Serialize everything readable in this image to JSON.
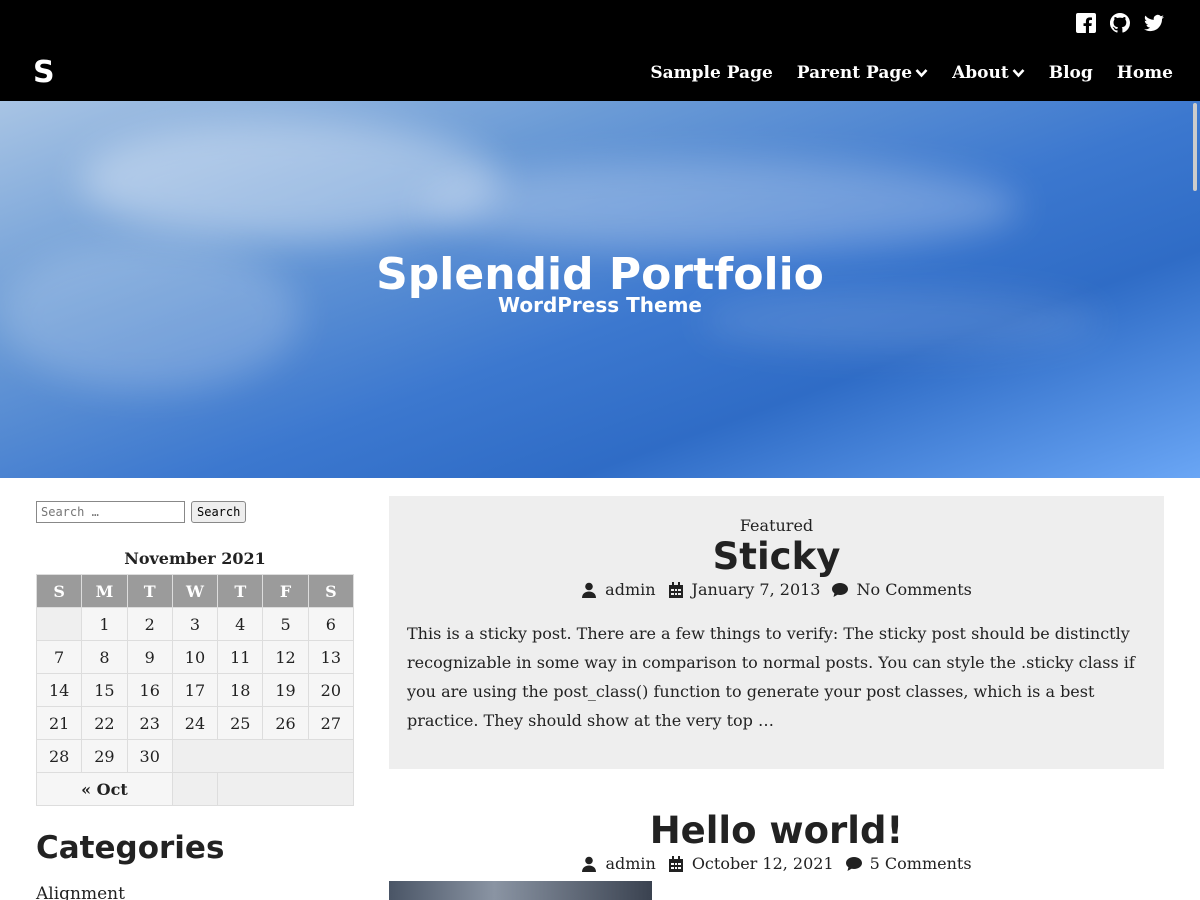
{
  "header": {
    "logo": "S",
    "social": [
      "facebook-icon",
      "github-icon",
      "twitter-icon"
    ],
    "nav": [
      {
        "label": "Sample Page",
        "dropdown": false
      },
      {
        "label": "Parent Page",
        "dropdown": true
      },
      {
        "label": "About",
        "dropdown": true
      },
      {
        "label": "Blog",
        "dropdown": false
      },
      {
        "label": "Home",
        "dropdown": false
      }
    ]
  },
  "hero": {
    "title": "Splendid Portfolio",
    "subtitle": "WordPress Theme"
  },
  "sidebar": {
    "search": {
      "placeholder": "Search …",
      "button": "Search"
    },
    "calendar": {
      "caption": "November 2021",
      "weekdays": [
        "S",
        "M",
        "T",
        "W",
        "T",
        "F",
        "S"
      ],
      "weeks": [
        [
          "",
          "1",
          "2",
          "3",
          "4",
          "5",
          "6"
        ],
        [
          "7",
          "8",
          "9",
          "10",
          "11",
          "12",
          "13"
        ],
        [
          "14",
          "15",
          "16",
          "17",
          "18",
          "19",
          "20"
        ],
        [
          "21",
          "22",
          "23",
          "24",
          "25",
          "26",
          "27"
        ],
        [
          "28",
          "29",
          "30",
          "",
          "",
          "",
          ""
        ]
      ],
      "prev": "« Oct"
    },
    "categories": {
      "title": "Categories",
      "items": [
        "Alignment"
      ]
    }
  },
  "posts": [
    {
      "label": "Featured",
      "title": "Sticky",
      "author": "admin",
      "date": "January 7, 2013",
      "comments": "No Comments",
      "excerpt": "This is a sticky post. There are a few things to verify: The sticky post should be distinctly recognizable in some way in comparison to normal posts. You can style the .sticky class if you are using the post_class() function to generate your post classes, which is a best practice. They should show at the very top …"
    },
    {
      "title": "Hello world!",
      "author": "admin",
      "date": "October 12, 2021",
      "comments": "5 Comments"
    }
  ],
  "colors": {
    "header_bg": "#000000",
    "post_bg": "#eeeeee",
    "calendar_header": "#9b9b9b",
    "hero_blue": "#3c78cf"
  }
}
